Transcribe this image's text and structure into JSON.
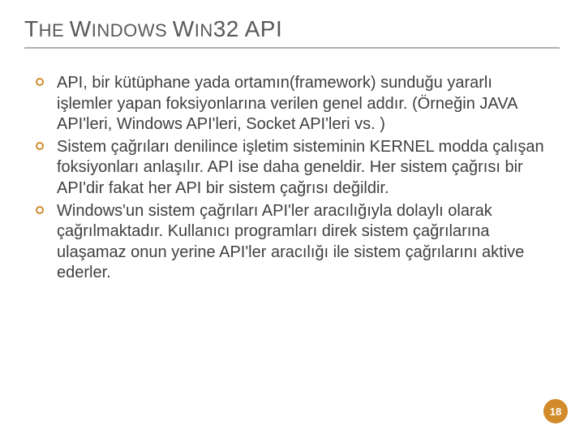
{
  "title_parts": {
    "p1_big": "T",
    "p1_small": "HE ",
    "p2_big": "W",
    "p2_small": "INDOWS ",
    "p3_big": "W",
    "p3_small": "IN",
    "p4_big": "32 API"
  },
  "bullets": [
    "API, bir kütüphane yada ortamın(framework) sunduğu yararlı işlemler yapan foksiyonlarına verilen genel addır. (Örneğin JAVA API'leri, Windows API'leri, Socket API'leri vs. )",
    "Sistem çağrıları denilince işletim sisteminin KERNEL modda çalışan foksiyonları anlaşılır. API ise daha geneldir. Her sistem çağrısı bir API'dir fakat her API bir sistem çağrısı değildir.",
    "Windows'un sistem çağrıları API'ler aracılığıyla dolaylı olarak çağrılmaktadır. Kullanıcı programları direk sistem çağrılarına ulaşamaz onun yerine API'ler aracılığı ile sistem çağrılarını aktive ederler."
  ],
  "page_number": "18",
  "colors": {
    "accent": "#d38a2a",
    "bullet_ring": "#cf8b2e",
    "title_underline": "#b0b0b0",
    "text": "#404040"
  }
}
